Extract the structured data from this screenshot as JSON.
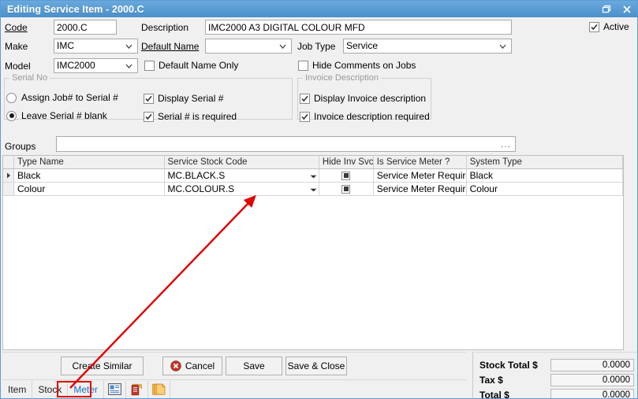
{
  "window": {
    "title": "Editing Service Item - 2000.C",
    "restore_icon": "restore-window-icon",
    "close_icon": "close-icon",
    "title_bar_color": "#5b9bd5"
  },
  "form": {
    "active_checkbox": {
      "label": "Active",
      "checked": true
    },
    "code": {
      "label": "Code",
      "value": "2000.C"
    },
    "description": {
      "label": "Description",
      "value": "IMC2000 A3 DIGITAL COLOUR MFD"
    },
    "make": {
      "label": "Make",
      "value": "IMC"
    },
    "default_name": {
      "label": "Default Name",
      "value": ""
    },
    "job_type": {
      "label": "Job Type",
      "value": "Service"
    },
    "model": {
      "label": "Model",
      "value": "IMC2000"
    },
    "default_name_only": {
      "label": "Default Name Only",
      "checked": false
    },
    "hide_comments_on_jobs": {
      "label": "Hide Comments on Jobs",
      "checked": false
    },
    "groups": {
      "label": "Groups",
      "value": "",
      "ellipsis": "..."
    }
  },
  "serial_no_group": {
    "title": "Serial No",
    "assign_job_to_serial": {
      "label": "Assign Job# to Serial #",
      "selected": false
    },
    "leave_serial_blank": {
      "label": "Leave Serial # blank",
      "selected": true
    },
    "display_serial": {
      "label": "Display Serial #",
      "checked": true
    },
    "serial_required": {
      "label": "Serial # is required",
      "checked": true
    }
  },
  "invoice_description_group": {
    "title": "Invoice Description",
    "display_invoice_description": {
      "label": "Display Invoice description",
      "checked": true
    },
    "invoice_description_required": {
      "label": "Invoice description required",
      "checked": true
    }
  },
  "grid": {
    "columns": [
      "Type Name",
      "Service Stock Code",
      "Hide Inv Svc",
      "Is Service Meter ?",
      "System Type"
    ],
    "rows": [
      {
        "indicator": "current-row-arrow",
        "type_name": "Black",
        "service_stock_code": "MC.BLACK.S",
        "hide_inv_svc": true,
        "is_service_meter": "Service Meter Require",
        "system_type": "Black"
      },
      {
        "indicator": "",
        "type_name": "Colour",
        "service_stock_code": "MC.COLOUR.S",
        "hide_inv_svc": true,
        "is_service_meter": "Service Meter Require",
        "system_type": "Colour"
      }
    ]
  },
  "buttons": {
    "create_similar": "Create Similar",
    "cancel": "Cancel",
    "cancel_icon": "cancel-circle-x-icon",
    "save": "Save",
    "save_and_close": "Save & Close"
  },
  "totals": {
    "stock_total_label": "Stock Total $",
    "stock_total_value": "0.0000",
    "tax_label": "Tax $",
    "tax_value": "0.0000",
    "total_label": "Total $",
    "total_value": "0.0000"
  },
  "tabs": {
    "items": [
      {
        "label": "Item",
        "active": false
      },
      {
        "label": "Stock",
        "active": false
      },
      {
        "label": "Meter",
        "active": true
      }
    ],
    "icons": [
      {
        "name": "report-list-icon"
      },
      {
        "name": "clipboard-icon"
      },
      {
        "name": "copy-pages-icon"
      }
    ]
  },
  "annotations": {
    "arrow_color": "#e00000",
    "highlight_color": "#e00000",
    "highlight_target": "Meter"
  }
}
